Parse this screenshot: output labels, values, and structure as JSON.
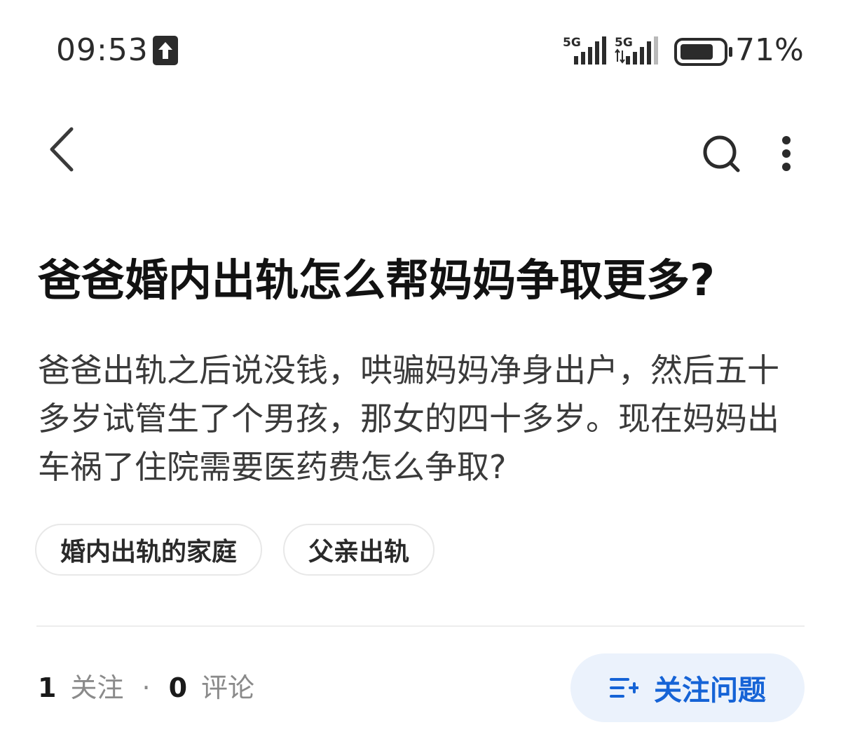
{
  "status_bar": {
    "time": "09:53",
    "network_1": "5G",
    "network_2": "5G",
    "battery": "71%",
    "icons": [
      "upload-icon",
      "signal-icon",
      "signal-icon",
      "battery-icon"
    ]
  },
  "nav": {
    "icons": [
      "back-chevron-icon",
      "search-icon",
      "more-vertical-icon"
    ]
  },
  "question": {
    "title": "爸爸婚内出轨怎么帮妈妈争取更多?",
    "detail": "爸爸出轨之后说没钱，哄骗妈妈净身出户，然后五十多岁试管生了个男孩，那女的四十多岁。现在妈妈出车祸了住院需要医药费怎么争取?",
    "topics": [
      "婚内出轨的家庭",
      "父亲出轨"
    ]
  },
  "footer": {
    "followers_count": "1",
    "followers_label": "关注",
    "separator": "·",
    "comments_count": "0",
    "comments_label": "评论",
    "follow_button_label": "关注问题"
  },
  "colors": {
    "accent": "#1563d6",
    "follow_button_bg": "#ebf2fc",
    "title": "#121212",
    "body_text": "#3a3a3a",
    "muted": "#8a8a8a"
  }
}
